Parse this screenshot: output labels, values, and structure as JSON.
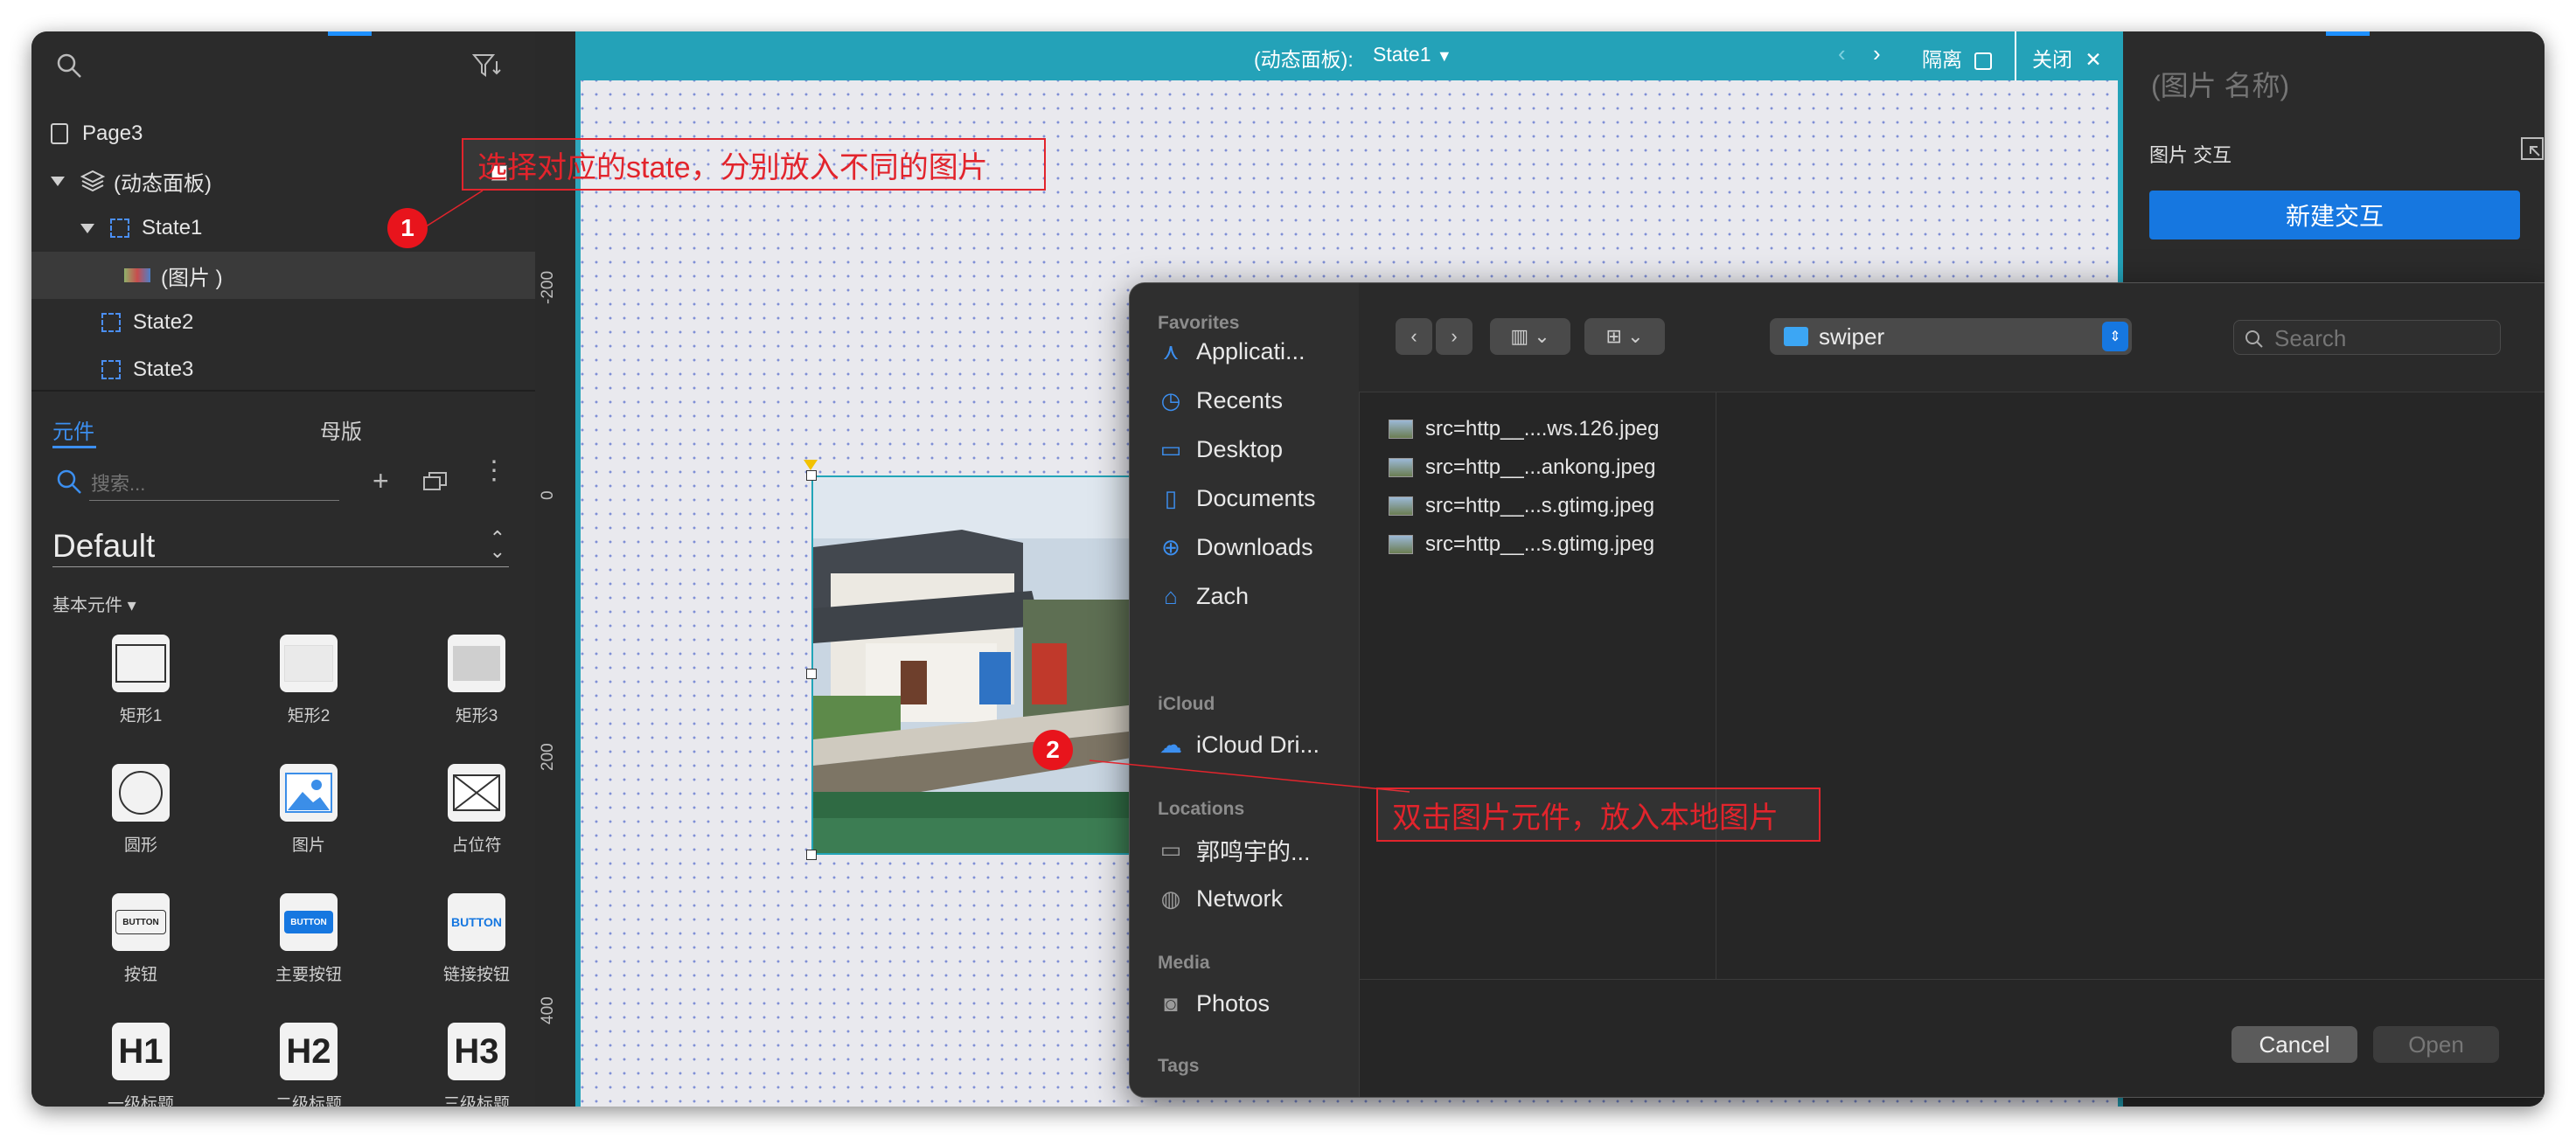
{
  "panel_bar": {
    "panel_label": "(动态面板):",
    "state_selected": "State1",
    "isolate_label": "隔离",
    "close_label": "关闭"
  },
  "outline": {
    "page": "Page3",
    "dynamic_panel": "(动态面板)",
    "states": [
      "State1",
      "State2",
      "State3"
    ],
    "image_child": "(图片 )"
  },
  "library": {
    "tab_components": "元件",
    "tab_masters": "母版",
    "search_placeholder": "搜索...",
    "library_name": "Default",
    "category": "基本元件",
    "items": [
      {
        "label": "矩形1",
        "icon": "rect-outline-icon"
      },
      {
        "label": "矩形2",
        "icon": "rect-light-icon"
      },
      {
        "label": "矩形3",
        "icon": "rect-gray-icon"
      },
      {
        "label": "圆形",
        "icon": "circle-icon"
      },
      {
        "label": "图片",
        "icon": "image-icon"
      },
      {
        "label": "占位符",
        "icon": "placeholder-icon"
      },
      {
        "label": "按钮",
        "icon": "button-icon",
        "glyph": "BUTTON"
      },
      {
        "label": "主要按钮",
        "icon": "primary-button-icon",
        "glyph": "BUTTON"
      },
      {
        "label": "链接按钮",
        "icon": "link-button-icon",
        "glyph": "BUTTON"
      },
      {
        "label": "一级标题",
        "icon": "h1-icon",
        "glyph": "H1"
      },
      {
        "label": "二级标题",
        "icon": "h2-icon",
        "glyph": "H2"
      },
      {
        "label": "三级标题",
        "icon": "h3-icon",
        "glyph": "H3"
      }
    ]
  },
  "ruler": {
    "marks": [
      "-200",
      "0",
      "200",
      "400"
    ]
  },
  "right_panel": {
    "name_placeholder": "(图片 名称)",
    "section_title": "图片 交互",
    "new_interaction": "新建交互"
  },
  "dialog": {
    "sidebar": {
      "favorites_head": "Favorites",
      "favorites": [
        {
          "label": "Applicati...",
          "icon": "applications-icon"
        },
        {
          "label": "Recents",
          "icon": "clock-icon"
        },
        {
          "label": "Desktop",
          "icon": "desktop-icon"
        },
        {
          "label": "Documents",
          "icon": "document-icon"
        },
        {
          "label": "Downloads",
          "icon": "download-icon"
        },
        {
          "label": "Zach",
          "icon": "home-icon"
        }
      ],
      "icloud_head": "iCloud",
      "icloud": [
        {
          "label": "iCloud Dri...",
          "icon": "cloud-icon"
        }
      ],
      "locations_head": "Locations",
      "locations": [
        {
          "label": "郭鸣宇的...",
          "icon": "laptop-icon"
        },
        {
          "label": "Network",
          "icon": "globe-icon"
        }
      ],
      "media_head": "Media",
      "media": [
        {
          "label": "Photos",
          "icon": "camera-icon"
        }
      ],
      "tags_head": "Tags"
    },
    "folder": "swiper",
    "search_placeholder": "Search",
    "files": [
      "src=http__....ws.126.jpeg",
      "src=http__...ankong.jpeg",
      "src=http__...s.gtimg.jpeg",
      "src=http__...s.gtimg.jpeg"
    ],
    "cancel_label": "Cancel",
    "open_label": "Open"
  },
  "annotations": {
    "note1": "选择对应的state，分别放入不同的图片",
    "badge1": "1",
    "note2": "双击图片元件，放入本地图片",
    "badge2": "2"
  },
  "colors": {
    "panel_teal": "#24a2b8",
    "accent_blue": "#1677e0",
    "annotation_red": "#e2242c"
  }
}
